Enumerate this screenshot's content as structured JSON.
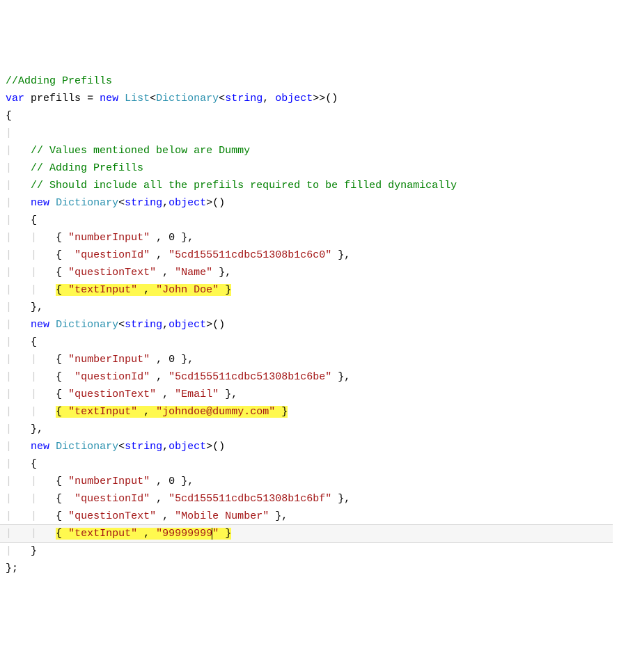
{
  "code": {
    "c_adding_prefills": "//Adding Prefills",
    "kw_var": "var",
    "id_prefills": "prefills",
    "kw_new": "new",
    "ty_List": "List",
    "ty_Dictionary": "Dictionary",
    "ty_string": "string",
    "ty_object": "object",
    "c_values_dummy": "// Values mentioned below are Dummy",
    "c_adding_prefills2": "// Adding Prefills",
    "c_should_include": "// Should include all the prefiils required to be filled dynamically",
    "s_numberInput": "\"numberInput\"",
    "n_zero": "0",
    "s_questionId": "\"questionId\"",
    "s_questionText": "\"questionText\"",
    "s_textInput": "\"textInput\"",
    "s_qid1": "\"5cd155511cdbc51308b1c6c0\"",
    "s_name": "\"Name\"",
    "s_john_doe": "\"John Doe\"",
    "s_qid2": "\"5cd155511cdbc51308b1c6be\"",
    "s_email": "\"Email\"",
    "s_johndoe_email": "\"johndoe@dummy.com\"",
    "s_qid3": "\"5cd155511cdbc51308b1c6bf\"",
    "s_mobile": "\"Mobile Number\"",
    "s_phone_a": "\"9999999",
    "s_phone_b": "9",
    "s_phone_c": "\""
  }
}
